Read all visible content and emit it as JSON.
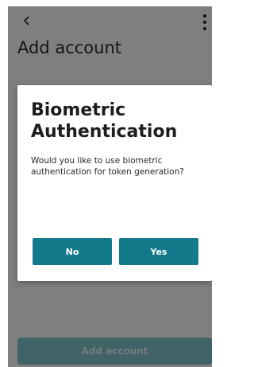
{
  "header": {
    "back_icon": "chevron-left-icon",
    "more_icon": "more-vertical-icon",
    "title": "Add account"
  },
  "footer": {
    "primary_button_label": "Add account"
  },
  "dialog": {
    "title": "Biometric Authentication",
    "message": "Would you like to use biometric authentication for token generation?",
    "no_label": "No",
    "yes_label": "Yes"
  },
  "colors": {
    "accent": "#137a8c",
    "disabled_button": "#7fc7cf",
    "scrim": "rgba(0,0,0,0.5)"
  }
}
